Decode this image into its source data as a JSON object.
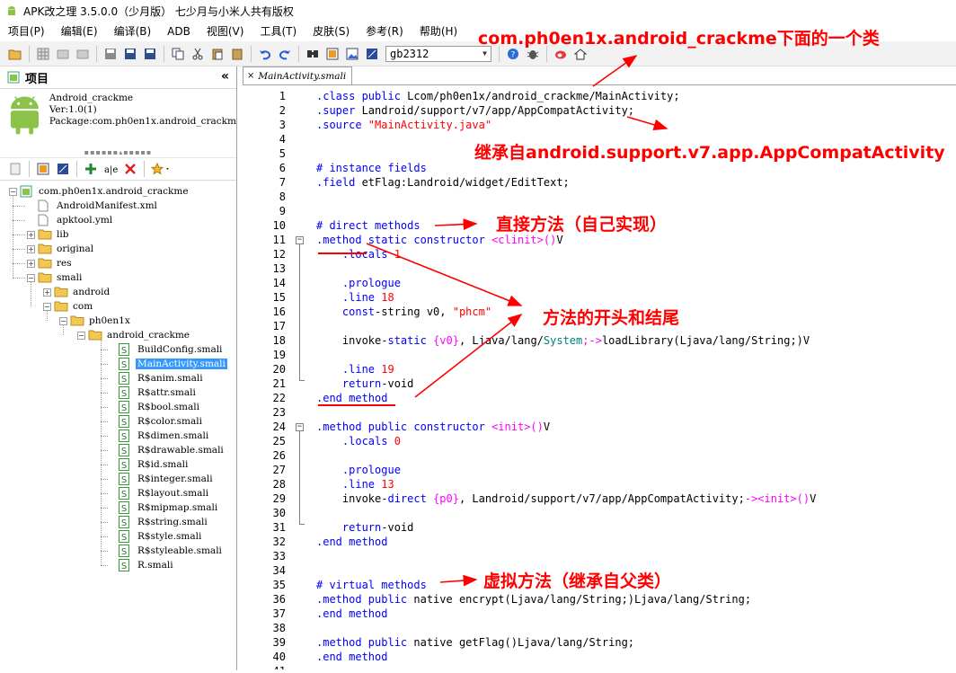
{
  "window": {
    "title": "APK改之理 3.5.0.0（少月版） 七少月与小米人共有版权"
  },
  "menu": [
    "项目(P)",
    "编辑(E)",
    "编译(B)",
    "ADB",
    "视图(V)",
    "工具(T)",
    "皮肤(S)",
    "参考(R)",
    "帮助(H)"
  ],
  "toolbar": {
    "encoding": "gb2312"
  },
  "project_panel": {
    "title": "项目",
    "collapse": "«",
    "app_name": "Android_crackme",
    "version": "Ver:1.0(1)",
    "package": "Package:com.ph0en1x.android_crackm"
  },
  "tree": {
    "root": "com.ph0en1x.android_crackme",
    "manifest": "AndroidManifest.xml",
    "apktool": "apktool.yml",
    "lib": "lib",
    "original": "original",
    "res": "res",
    "smali": "smali",
    "android": "android",
    "com": "com",
    "ph0en1x": "ph0en1x",
    "android_crackme": "android_crackme",
    "files": [
      "BuildConfig.smali",
      "MainActivity.smali",
      "R$anim.smali",
      "R$attr.smali",
      "R$bool.smali",
      "R$color.smali",
      "R$dimen.smali",
      "R$drawable.smali",
      "R$id.smali",
      "R$integer.smali",
      "R$layout.smali",
      "R$mipmap.smali",
      "R$string.smali",
      "R$style.smali",
      "R$styleable.smali",
      "R.smali"
    ],
    "selected_file": "MainActivity.smali"
  },
  "editor": {
    "tab_label": "MainActivity.smali",
    "tab_close": "×",
    "line_numbers": [
      "1",
      "2",
      "3",
      "4",
      "5",
      "6",
      "7",
      "8",
      "9",
      "10",
      "11",
      "12",
      "13",
      "14",
      "15",
      "16",
      "17",
      "18",
      "19",
      "20",
      "21",
      "22",
      "23",
      "24",
      "25",
      "26",
      "27",
      "28",
      "29",
      "30",
      "31",
      "32",
      "33",
      "34",
      "35",
      "36",
      "37",
      "38",
      "39",
      "40",
      "41"
    ]
  },
  "code_lines": [
    [
      {
        "c": "kw",
        "t": ".class public "
      },
      {
        "c": "",
        "t": "Lcom/ph0en1x/android_crackme/MainActivity;"
      }
    ],
    [
      {
        "c": "kw",
        "t": ".super "
      },
      {
        "c": "",
        "t": "Landroid/support/v7/app/AppCompatActivity;"
      }
    ],
    [
      {
        "c": "kw",
        "t": ".source "
      },
      {
        "c": "str",
        "t": "\"MainActivity.java\""
      }
    ],
    [],
    [],
    [
      {
        "c": "cm",
        "t": "# instance fields"
      }
    ],
    [
      {
        "c": "kw",
        "t": ".field "
      },
      {
        "c": "",
        "t": "etFlag:Landroid/widget/EditText;"
      }
    ],
    [],
    [],
    [
      {
        "c": "cm",
        "t": "# direct methods"
      }
    ],
    [
      {
        "c": "kw",
        "t": ".method static constructor "
      },
      {
        "c": "reg",
        "t": "<clinit>()"
      },
      {
        "c": "",
        "t": "V"
      }
    ],
    [
      {
        "c": "",
        "t": "    "
      },
      {
        "c": "kw",
        "t": ".locals "
      },
      {
        "c": "str",
        "t": "1"
      }
    ],
    [],
    [
      {
        "c": "",
        "t": "    "
      },
      {
        "c": "kw",
        "t": ".prologue"
      }
    ],
    [
      {
        "c": "",
        "t": "    "
      },
      {
        "c": "kw",
        "t": ".line "
      },
      {
        "c": "str",
        "t": "18"
      }
    ],
    [
      {
        "c": "",
        "t": "    "
      },
      {
        "c": "kw",
        "t": "const"
      },
      {
        "c": "",
        "t": "-string v0, "
      },
      {
        "c": "str",
        "t": "\"phcm\""
      }
    ],
    [],
    [
      {
        "c": "",
        "t": "    invoke-"
      },
      {
        "c": "kw",
        "t": "static "
      },
      {
        "c": "reg",
        "t": "{v0}"
      },
      {
        "c": "",
        "t": ", Ljava/lang/"
      },
      {
        "c": "pk",
        "t": "System"
      },
      {
        "c": "reg",
        "t": ";->"
      },
      {
        "c": "",
        "t": "loadLibrary(Ljava/lang/String;)V"
      }
    ],
    [],
    [
      {
        "c": "",
        "t": "    "
      },
      {
        "c": "kw",
        "t": ".line "
      },
      {
        "c": "str",
        "t": "19"
      }
    ],
    [
      {
        "c": "",
        "t": "    "
      },
      {
        "c": "kw",
        "t": "return"
      },
      {
        "c": "",
        "t": "-void"
      }
    ],
    [
      {
        "c": "kw",
        "t": ".end method"
      }
    ],
    [],
    [
      {
        "c": "kw",
        "t": ".method public constructor "
      },
      {
        "c": "reg",
        "t": "<init>()"
      },
      {
        "c": "",
        "t": "V"
      }
    ],
    [
      {
        "c": "",
        "t": "    "
      },
      {
        "c": "kw",
        "t": ".locals "
      },
      {
        "c": "str",
        "t": "0"
      }
    ],
    [],
    [
      {
        "c": "",
        "t": "    "
      },
      {
        "c": "kw",
        "t": ".prologue"
      }
    ],
    [
      {
        "c": "",
        "t": "    "
      },
      {
        "c": "kw",
        "t": ".line "
      },
      {
        "c": "str",
        "t": "13"
      }
    ],
    [
      {
        "c": "",
        "t": "    invoke-"
      },
      {
        "c": "kw",
        "t": "direct "
      },
      {
        "c": "reg",
        "t": "{p0}"
      },
      {
        "c": "",
        "t": ", Landroid/support/v7/app/AppCompatActivity;"
      },
      {
        "c": "reg",
        "t": "-><init>()"
      },
      {
        "c": "",
        "t": "V"
      }
    ],
    [],
    [
      {
        "c": "",
        "t": "    "
      },
      {
        "c": "kw",
        "t": "return"
      },
      {
        "c": "",
        "t": "-void"
      }
    ],
    [
      {
        "c": "kw",
        "t": ".end method"
      }
    ],
    [],
    [],
    [
      {
        "c": "cm",
        "t": "# virtual methods"
      }
    ],
    [
      {
        "c": "kw",
        "t": ".method public "
      },
      {
        "c": "",
        "t": "native encrypt(Ljava/lang/String;)Ljava/lang/String;"
      }
    ],
    [
      {
        "c": "kw",
        "t": ".end method"
      }
    ],
    [],
    [
      {
        "c": "kw",
        "t": ".method public "
      },
      {
        "c": "",
        "t": "native getFlag()Ljava/lang/String;"
      }
    ],
    [
      {
        "c": "kw",
        "t": ".end method"
      }
    ],
    []
  ],
  "annotations": {
    "class_note": "com.ph0en1x.android_crackme下面的一个类",
    "super_note": "继承自android.support.v7.app.AppCompatActivity",
    "direct_note": "直接方法（自己实现）",
    "method_note": "方法的开头和结尾",
    "virtual_note": "虚拟方法（继承自父类）"
  },
  "colors": {
    "annotation": "#ff0000",
    "keyword": "#0000ff",
    "string": "#ff0000",
    "selection": "#3399ff"
  }
}
